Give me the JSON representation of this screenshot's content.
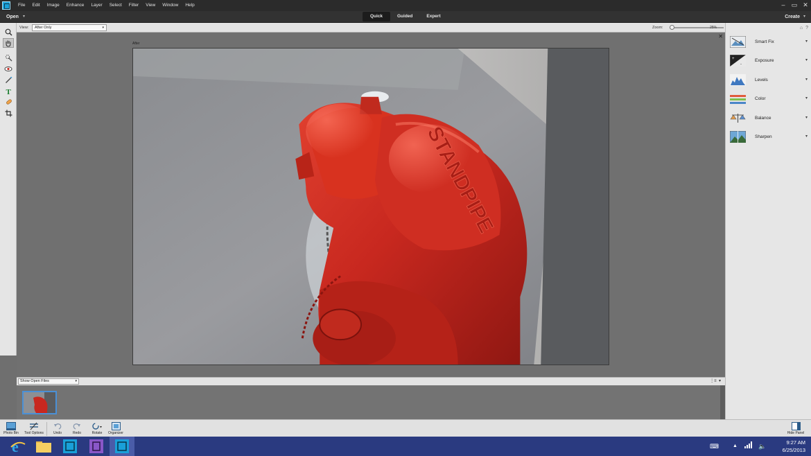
{
  "menu": [
    "File",
    "Edit",
    "Image",
    "Enhance",
    "Layer",
    "Select",
    "Filter",
    "View",
    "Window",
    "Help"
  ],
  "window_controls": [
    "–",
    "▭",
    "✕"
  ],
  "modebar": {
    "open_label": "Open",
    "modes": [
      "Quick",
      "Guided",
      "Expert"
    ],
    "active_mode": "Quick",
    "create_label": "Create"
  },
  "options": {
    "view_label": "View:",
    "view_value": "After Only",
    "zoom_label": "Zoom:",
    "zoom_value": "25%",
    "zoom_fraction": 0.05
  },
  "canvas": {
    "caption": "After"
  },
  "photo_text": {
    "embossed": "STANDPIPE"
  },
  "bin": {
    "select_value": "Show Open Files"
  },
  "adjustments": [
    "Smart Fix",
    "Exposure",
    "Levels",
    "Color",
    "Balance",
    "Sharpen"
  ],
  "taskbar": [
    {
      "label": "Photo Bin",
      "icon": "photo-bin-icon"
    },
    {
      "label": "Tool Options",
      "icon": "tool-options-icon"
    },
    {
      "label": "Undo",
      "icon": "undo-icon"
    },
    {
      "label": "Redo",
      "icon": "redo-icon"
    },
    {
      "label": "Rotate",
      "icon": "rotate-icon"
    },
    {
      "label": "Organizer",
      "icon": "organizer-icon"
    }
  ],
  "hide_panel_label": "Hide Panel",
  "clock": {
    "time": "9:27 AM",
    "date": "6/25/2013"
  },
  "colors": {
    "accent": "#1aa0d8",
    "hydrant_red": "#c8281f",
    "taskbar_blue": "#2a3a80"
  }
}
